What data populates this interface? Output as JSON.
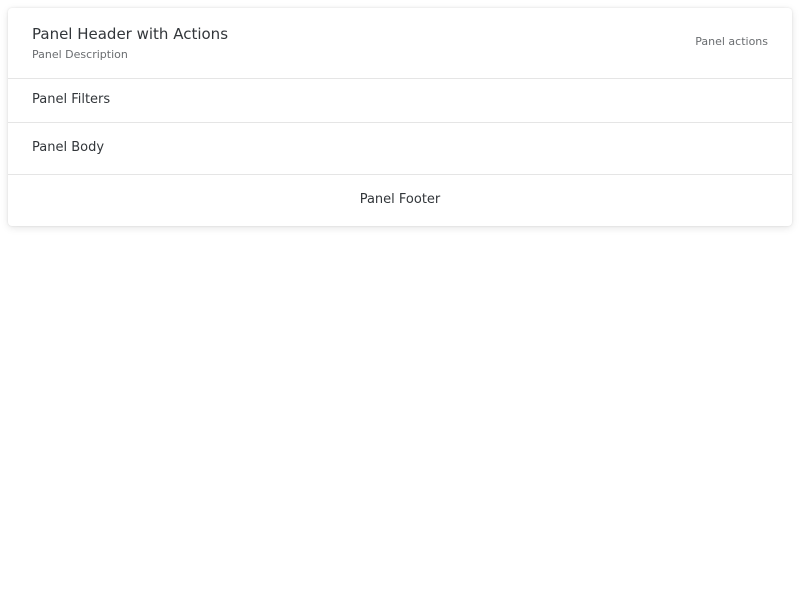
{
  "panel": {
    "header": {
      "title": "Panel Header with Actions",
      "description": "Panel Description",
      "actions": "Panel actions"
    },
    "filters": {
      "label": "Panel Filters"
    },
    "body": {
      "label": "Panel Body"
    },
    "footer": {
      "label": "Panel Footer"
    }
  }
}
